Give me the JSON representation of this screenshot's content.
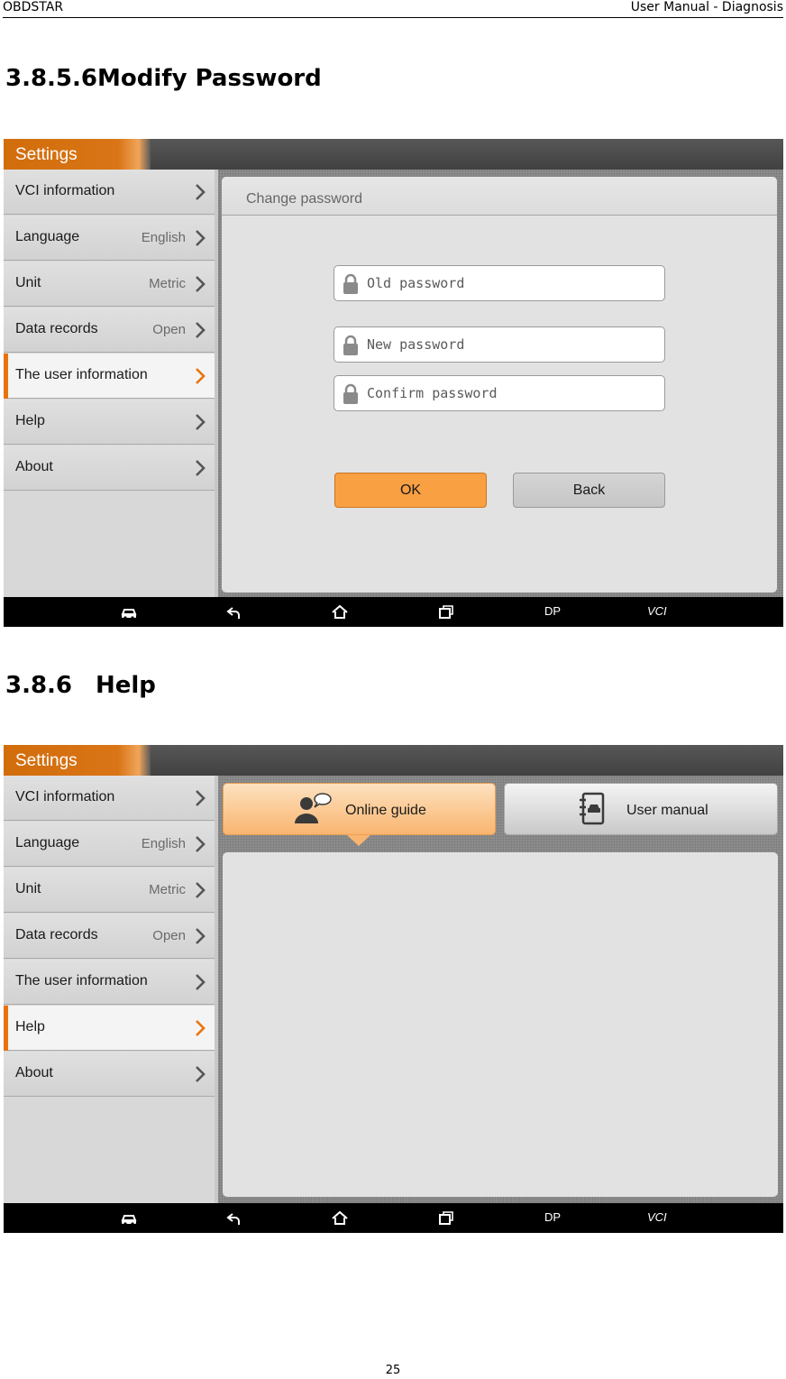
{
  "header": {
    "left": "OBDSTAR",
    "right": "User Manual - Diagnosis"
  },
  "section1": {
    "number": "3.8.5.6",
    "title": "Modify Password"
  },
  "section2": {
    "number": "3.8.6",
    "title": "Help"
  },
  "page_number": "25",
  "settings": {
    "title": "Settings",
    "items": [
      {
        "label": "VCI information",
        "value": ""
      },
      {
        "label": "Language",
        "value": "English"
      },
      {
        "label": "Unit",
        "value": "Metric"
      },
      {
        "label": "Data records",
        "value": "Open"
      },
      {
        "label": "The user information",
        "value": ""
      },
      {
        "label": "Help",
        "value": ""
      },
      {
        "label": "About",
        "value": ""
      }
    ]
  },
  "change_password": {
    "title": "Change password",
    "old_placeholder": "Old password",
    "new_placeholder": "New password",
    "confirm_placeholder": "Confirm password",
    "ok_label": "OK",
    "back_label": "Back"
  },
  "help": {
    "online_guide": "Online guide",
    "user_manual": "User manual"
  },
  "navbar": {
    "dp_label": "DP",
    "vci_label": "VCI"
  },
  "colors": {
    "accent": "#e8730c",
    "ok_button": "#f9a043",
    "navbar": "#000000"
  },
  "icons": [
    "lock-icon",
    "chevron-right-icon",
    "car-icon",
    "back-icon",
    "home-icon",
    "recent-apps-icon",
    "user-chat-icon",
    "manual-book-icon"
  ]
}
